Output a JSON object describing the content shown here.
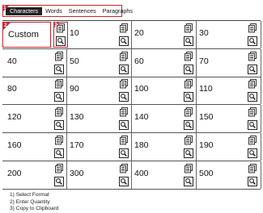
{
  "tabs": [
    {
      "label": "Characters",
      "active": true
    },
    {
      "label": "Words",
      "active": false
    },
    {
      "label": "Sentences",
      "active": false
    },
    {
      "label": "Paragraphs",
      "active": false
    }
  ],
  "steps": {
    "one": "1",
    "two": "2",
    "three": "3"
  },
  "custom_label": "Custom",
  "quantities": [
    "10",
    "20",
    "30",
    "40",
    "50",
    "60",
    "70",
    "80",
    "90",
    "100",
    "110",
    "120",
    "130",
    "140",
    "150",
    "160",
    "170",
    "180",
    "190",
    "200",
    "300",
    "400",
    "500"
  ],
  "icons": {
    "copy": "copy-document-icon",
    "preview": "magnifier-preview-icon"
  },
  "instructions": [
    "1) Select Format",
    "2) Enter Quantity",
    "3) Copy to Clipboard"
  ],
  "colors": {
    "accent": "#c9232b",
    "active_tab": "#222222"
  }
}
